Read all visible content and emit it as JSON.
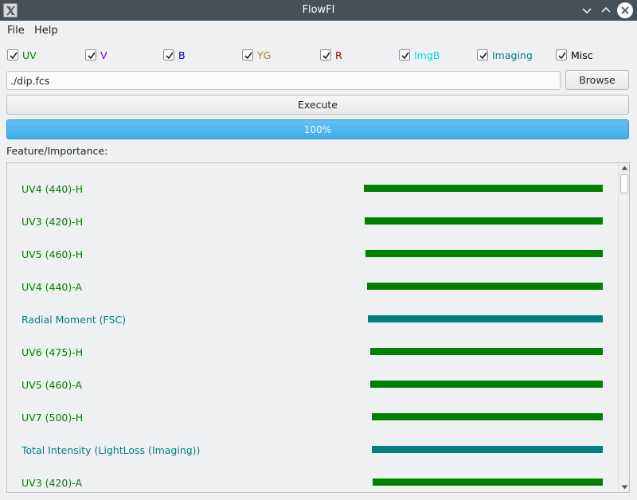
{
  "window": {
    "title": "FlowFI",
    "app_icon": "x-app-icon",
    "controls": [
      "minimize-icon",
      "maximize-icon",
      "close-icon"
    ]
  },
  "menu": {
    "file": "File",
    "help": "Help"
  },
  "checkboxes": [
    {
      "label": "UV",
      "checked": true,
      "color": "#007f00"
    },
    {
      "label": "V",
      "checked": true,
      "color": "#8a00c9"
    },
    {
      "label": "B",
      "checked": true,
      "color": "#0000c0"
    },
    {
      "label": "YG",
      "checked": true,
      "color": "#b8860b"
    },
    {
      "label": "R",
      "checked": true,
      "color": "#a00000"
    },
    {
      "label": "ImgB",
      "checked": true,
      "color": "#00e0e0"
    },
    {
      "label": "Imaging",
      "checked": true,
      "color": "#008080"
    },
    {
      "label": "Misc",
      "checked": true,
      "color": "#000000"
    }
  ],
  "file": {
    "path": "./dip.fcs",
    "browse_label": "Browse"
  },
  "execute_label": "Execute",
  "progress": {
    "value": 1.0,
    "text": "100%"
  },
  "features_label": "Feature/Importance:",
  "features": [
    {
      "name": "UV4 (440)-H",
      "importance": 1.0,
      "color": "#008000"
    },
    {
      "name": "UV3 (420)-H",
      "importance": 0.997,
      "color": "#008000"
    },
    {
      "name": "UV5 (460)-H",
      "importance": 0.993,
      "color": "#008000"
    },
    {
      "name": "UV4 (440)-A",
      "importance": 0.987,
      "color": "#008000"
    },
    {
      "name": "Radial Moment (FSC)",
      "importance": 0.983,
      "color": "#008080"
    },
    {
      "name": "UV6 (475)-H",
      "importance": 0.973,
      "color": "#008000"
    },
    {
      "name": "UV5 (460)-A",
      "importance": 0.973,
      "color": "#008000"
    },
    {
      "name": "UV7 (500)-H",
      "importance": 0.967,
      "color": "#008000"
    },
    {
      "name": "Total Intensity (LightLoss (Imaging))",
      "importance": 0.967,
      "color": "#008080"
    },
    {
      "name": "UV3 (420)-A",
      "importance": 0.963,
      "color": "#008000"
    }
  ],
  "scrollbar": {
    "position": 0.0
  }
}
